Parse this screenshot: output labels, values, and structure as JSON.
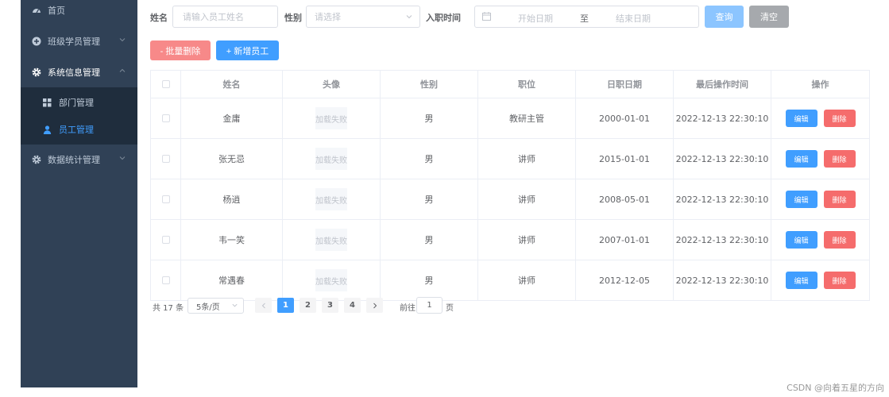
{
  "sidebar": {
    "home": "首页",
    "class_mgmt": "班级学员管理",
    "sys_mgmt": "系统信息管理",
    "dept_mgmt": "部门管理",
    "emp_mgmt": "员工管理",
    "stats_mgmt": "数据统计管理"
  },
  "search": {
    "name_label": "姓名",
    "name_placeholder": "请输入员工姓名",
    "gender_label": "性别",
    "gender_placeholder": "请选择",
    "date_label": "入职时间",
    "start_placeholder": "开始日期",
    "range_sep": "至",
    "end_placeholder": "结束日期",
    "query_btn": "查询",
    "clear_btn": "清空"
  },
  "toolbar": {
    "batch_delete": "- 批量删除",
    "add_employee": "+ 新增员工"
  },
  "table": {
    "headers": [
      "姓名",
      "头像",
      "性别",
      "职位",
      "日职日期",
      "最后操作时间",
      "操作"
    ],
    "avatar_fail": "加载失败",
    "edit_label": "编辑",
    "delete_label": "删除",
    "rows": [
      {
        "name": "金庸",
        "gender": "男",
        "position": "教研主管",
        "entry": "2000-01-01",
        "updated": "2022-12-13 22:30:10"
      },
      {
        "name": "张无忌",
        "gender": "男",
        "position": "讲师",
        "entry": "2015-01-01",
        "updated": "2022-12-13 22:30:10"
      },
      {
        "name": "杨逍",
        "gender": "男",
        "position": "讲师",
        "entry": "2008-05-01",
        "updated": "2022-12-13 22:30:10"
      },
      {
        "name": "韦一笑",
        "gender": "男",
        "position": "讲师",
        "entry": "2007-01-01",
        "updated": "2022-12-13 22:30:10"
      },
      {
        "name": "常遇春",
        "gender": "男",
        "position": "讲师",
        "entry": "2012-12-05",
        "updated": "2022-12-13 22:30:10"
      }
    ]
  },
  "pagination": {
    "total": "共 17 条",
    "page_size": "5条/页",
    "pages": [
      "1",
      "2",
      "3",
      "4"
    ],
    "current": "1",
    "goto_prefix": "前往",
    "goto_value": "1",
    "goto_suffix": "页"
  },
  "watermark": "CSDN @向着五星的方向"
}
